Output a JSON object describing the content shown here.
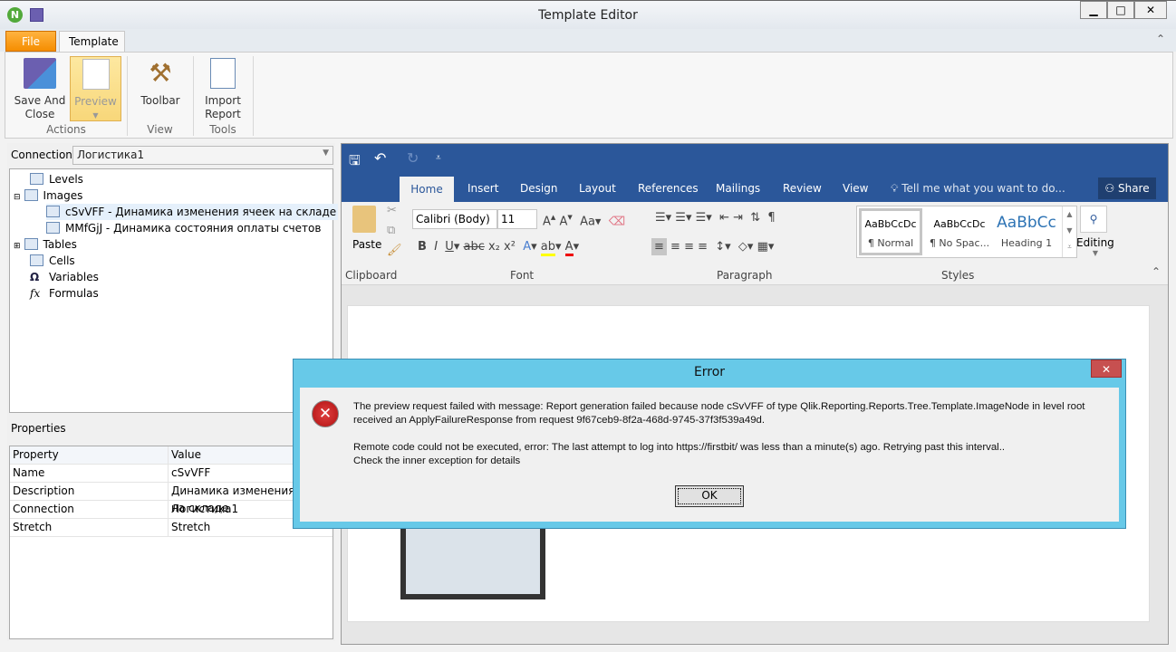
{
  "window": {
    "title": "Template Editor",
    "min": "▁",
    "max": "□",
    "close": "✕"
  },
  "ribbon": {
    "tabs": [
      "File",
      "Template"
    ],
    "buttons": {
      "save_close": "Save And Close",
      "preview": "Preview",
      "toolbar": "Toolbar",
      "import": "Import Report"
    },
    "groups": [
      "Actions",
      "View",
      "Tools"
    ]
  },
  "left": {
    "connection_label": "Connection",
    "connection_value": "Логистика1",
    "tree": [
      {
        "label": "Levels"
      },
      {
        "label": "Images"
      },
      {
        "label": "cSvVFF - Динамика изменения ячеек на складе"
      },
      {
        "label": "MMfGjJ - Динамика состояния оплаты счетов"
      },
      {
        "label": "Tables"
      },
      {
        "label": "Cells"
      },
      {
        "label": "Variables"
      },
      {
        "label": "Formulas"
      }
    ],
    "properties_title": "Properties",
    "prop_headers": [
      "Property",
      "Value"
    ],
    "props": [
      [
        "Name",
        "cSvVFF"
      ],
      [
        "Description",
        "Динамика изменения ячеек на складе"
      ],
      [
        "Connection",
        "Логистика1"
      ],
      [
        "Stretch",
        "Stretch"
      ]
    ]
  },
  "word": {
    "tabs": [
      "Home",
      "Insert",
      "Design",
      "Layout",
      "References",
      "Mailings",
      "Review",
      "View"
    ],
    "tell_me": "Tell me what you want to do...",
    "share": "Share",
    "paste": "Paste",
    "font": "Calibri (Body)",
    "size": "11",
    "styles": [
      {
        "preview": "AaBbCcDc",
        "name": "¶ Normal"
      },
      {
        "preview": "AaBbCcDc",
        "name": "¶ No Spac..."
      },
      {
        "preview": "AaBbCc",
        "name": "Heading 1"
      }
    ],
    "editing": "Editing",
    "groups": [
      "Clipboard",
      "Font",
      "Paragraph",
      "Styles"
    ]
  },
  "dialog": {
    "title": "Error",
    "close": "✕",
    "line1": "The preview request failed with message: Report generation failed because node cSvVFF of type Qlik.Reporting.Reports.Tree.Template.ImageNode in level root received an ApplyFailureResponse from request 9f67ceb9-8f2a-468d-9745-37f3f539a49d.",
    "line2": "Remote code could not be executed, error: The last attempt to log into https://firstbit/ was less than a minute(s) ago. Retrying past this interval..",
    "line3": "Check the inner exception for details",
    "ok": "OK"
  }
}
